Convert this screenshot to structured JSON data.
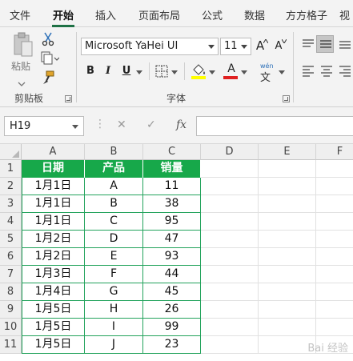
{
  "ribbon": {
    "tabs": [
      {
        "id": "file",
        "label": "文件"
      },
      {
        "id": "home",
        "label": "开始"
      },
      {
        "id": "insert",
        "label": "插入"
      },
      {
        "id": "page_layout",
        "label": "页面布局"
      },
      {
        "id": "formulas",
        "label": "公式"
      },
      {
        "id": "data",
        "label": "数据"
      },
      {
        "id": "fangfang",
        "label": "方方格子"
      },
      {
        "id": "more",
        "label": "视"
      }
    ],
    "active_tab": "开始",
    "clipboard": {
      "paste_label": "粘贴",
      "group_label": "剪贴板"
    },
    "font": {
      "font_name": "Microsoft YaHei UI",
      "font_size": "11",
      "bold": "B",
      "italic": "I",
      "underline": "U",
      "grow": "A",
      "shrink": "A",
      "font_color_letter": "A",
      "phonetic": "wén",
      "group_label": "字体"
    }
  },
  "formula_bar": {
    "name_box": "H19",
    "cancel_symbol": "✕",
    "enter_symbol": "✓",
    "fx_symbol": "fx",
    "value": ""
  },
  "sheet": {
    "column_headers": [
      "A",
      "B",
      "C",
      "D",
      "E",
      "F"
    ],
    "row_headers": [
      "1",
      "2",
      "3",
      "4",
      "5",
      "6",
      "7",
      "8",
      "9",
      "10",
      "11"
    ],
    "table_headers": [
      "日期",
      "产品",
      "销量"
    ],
    "rows": [
      [
        "1月1日",
        "A",
        "11"
      ],
      [
        "1月1日",
        "B",
        "38"
      ],
      [
        "1月1日",
        "C",
        "95"
      ],
      [
        "1月2日",
        "D",
        "47"
      ],
      [
        "1月2日",
        "E",
        "93"
      ],
      [
        "1月3日",
        "F",
        "44"
      ],
      [
        "1月4日",
        "G",
        "45"
      ],
      [
        "1月5日",
        "H",
        "26"
      ],
      [
        "1月5日",
        "I",
        "99"
      ],
      [
        "1月5日",
        "J",
        "23"
      ]
    ],
    "header_fill_color": "#17a84a",
    "table_border_color": "#23a35c"
  },
  "watermark": "Bai 经验"
}
